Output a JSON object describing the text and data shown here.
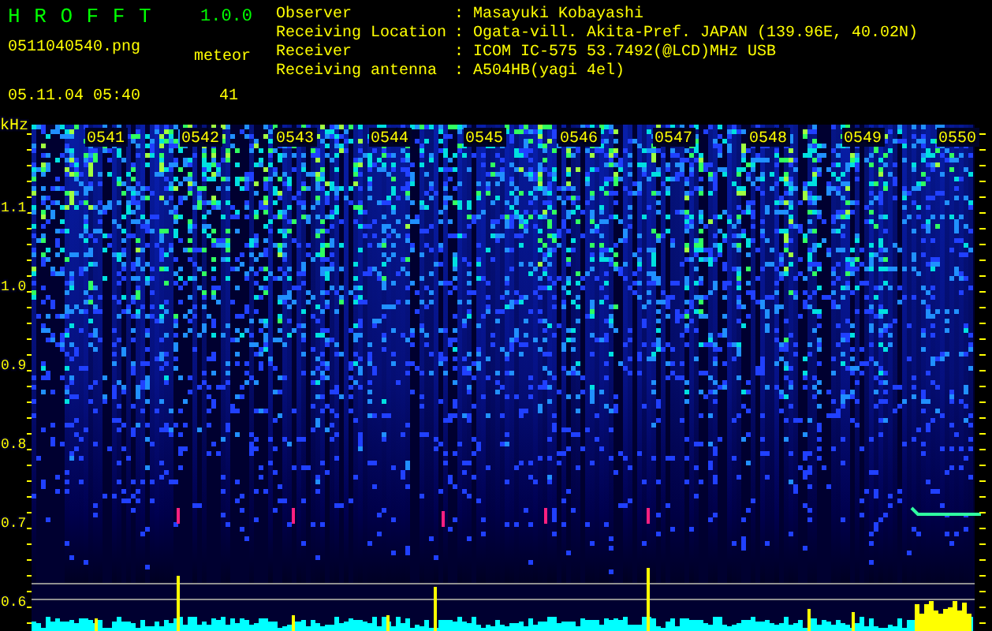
{
  "app": {
    "title": "H R O F F T",
    "version": "1.0.0"
  },
  "file": {
    "name": "0511040540.png",
    "datetime": "05.11.04 05:40"
  },
  "meteor": {
    "label": "meteor",
    "count": "41"
  },
  "info": [
    {
      "label": "Observer",
      "colon": ":",
      "value": "Masayuki Kobayashi"
    },
    {
      "label": "Receiving Location",
      "colon": ":",
      "value": "Ogata-vill. Akita-Pref. JAPAN (139.96E, 40.02N)"
    },
    {
      "label": "Receiver",
      "colon": ":",
      "value": "ICOM IC-575 53.7492(@LCD)MHz USB"
    },
    {
      "label": "Receiving antenna",
      "colon": ":",
      "value": "A504HB(yagi 4el)"
    }
  ],
  "plot": {
    "unit": "kHz",
    "freq_labels": [
      "1.1",
      "1.0",
      "0.9",
      "0.8",
      "0.7",
      "0.6"
    ],
    "time_labels": [
      "0541",
      "0542",
      "0543",
      "0544",
      "0545",
      "0546",
      "0547",
      "0548",
      "0549",
      "0550"
    ]
  }
}
